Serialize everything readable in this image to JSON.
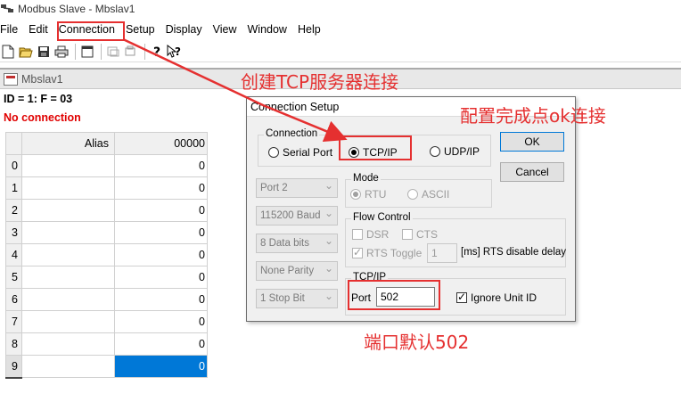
{
  "app": {
    "title": "Modbus Slave - Mbslav1"
  },
  "menu": [
    "File",
    "Edit",
    "Connection",
    "Setup",
    "Display",
    "View",
    "Window",
    "Help"
  ],
  "toolbar": {
    "icons": [
      "new-icon",
      "open-icon",
      "save-icon",
      "print-icon",
      "window-icon",
      "read-icon",
      "write-icon",
      "help-icon",
      "context-help-icon"
    ]
  },
  "child": {
    "title": "Mbslav1",
    "id_line": "ID = 1: F = 03",
    "status": "No connection"
  },
  "grid": {
    "headers": {
      "alias": "Alias",
      "address": "00000"
    },
    "rows": [
      {
        "index": "0",
        "value": "0"
      },
      {
        "index": "1",
        "value": "0"
      },
      {
        "index": "2",
        "value": "0"
      },
      {
        "index": "3",
        "value": "0"
      },
      {
        "index": "4",
        "value": "0"
      },
      {
        "index": "5",
        "value": "0"
      },
      {
        "index": "6",
        "value": "0"
      },
      {
        "index": "7",
        "value": "0"
      },
      {
        "index": "8",
        "value": "0"
      },
      {
        "index": "9",
        "value": "0"
      }
    ]
  },
  "dialog": {
    "title": "Connection Setup",
    "connection_group": "Connection",
    "serial_port": "Serial Port",
    "tcp_ip": "TCP/IP",
    "udp_ip": "UDP/IP",
    "ok": "OK",
    "cancel": "Cancel",
    "port_select": "Port 2",
    "baud_select": "115200 Baud",
    "data_bits_select": "8 Data bits",
    "parity_select": "None Parity",
    "stop_bits_select": "1 Stop Bit",
    "mode_group": "Mode",
    "rtu": "RTU",
    "ascii": "ASCII",
    "flow_group": "Flow Control",
    "dsr": "DSR",
    "cts": "CTS",
    "rts_toggle": "RTS Toggle",
    "rts_delay_value": "1",
    "rts_delay_label": "[ms] RTS disable delay",
    "tcpip_group": "TCP/IP",
    "port_label": "Port",
    "port_value": "502",
    "ignore_unit_id": "Ignore Unit ID"
  },
  "annotations": {
    "create_server": "创建TCP服务器连接",
    "config_ok": "配置完成点ok连接",
    "port_default": "端口默认502"
  },
  "colors": {
    "annotation": "#e53030",
    "selection": "#0078d7",
    "status_error": "#e00000"
  }
}
